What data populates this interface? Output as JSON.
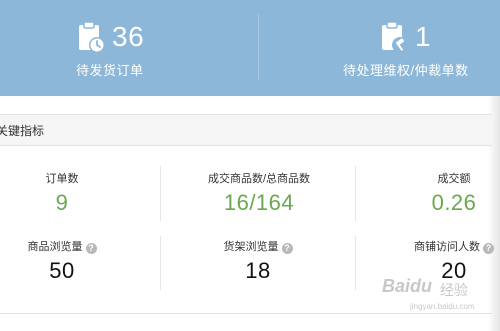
{
  "top_stats": [
    {
      "count": "36",
      "label": "待发货订单",
      "icon": "clipboard-clock-icon"
    },
    {
      "count": "1",
      "label": "待处理维权/仲裁单数",
      "icon": "clipboard-gavel-icon"
    }
  ],
  "section": {
    "title": "关键指标"
  },
  "metrics_row1": [
    {
      "label": "订单数",
      "value": "9"
    },
    {
      "label": "成交商品数/总商品数",
      "value": "16/164"
    },
    {
      "label": "成交额",
      "value": "0.26"
    }
  ],
  "metrics_row2": [
    {
      "label": "商品浏览量",
      "value": "50",
      "help_icon": "?"
    },
    {
      "label": "货架浏览量",
      "value": "18",
      "help_icon": "?"
    },
    {
      "label": "商铺访问人数",
      "value": "20",
      "help_icon": "?"
    }
  ],
  "watermark": {
    "brand": "Baidu",
    "sub": "经验",
    "url": "jingyan.baidu.com"
  },
  "colors": {
    "banner": "#8db7d8",
    "green_value": "#6aa84f"
  }
}
